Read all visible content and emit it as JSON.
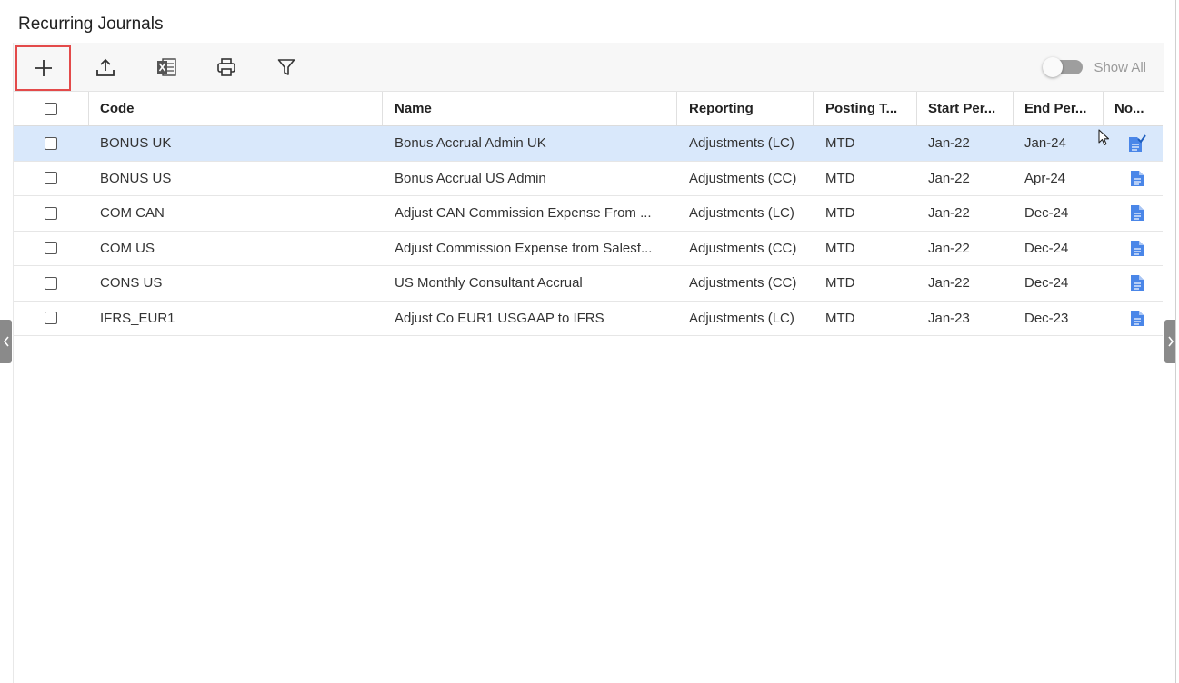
{
  "page": {
    "title": "Recurring Journals"
  },
  "toolbar": {
    "buttons": [
      {
        "name": "add-button",
        "icon": "plus-icon"
      },
      {
        "name": "upload-button",
        "icon": "upload-icon"
      },
      {
        "name": "excel-button",
        "icon": "excel-icon"
      },
      {
        "name": "print-button",
        "icon": "printer-icon"
      },
      {
        "name": "filter-button",
        "icon": "filter-icon"
      }
    ],
    "show_all": {
      "label": "Show All",
      "on": false
    }
  },
  "grid": {
    "columns": [
      "Code",
      "Name",
      "Reporting",
      "Posting T...",
      "Start Per...",
      "End Per...",
      "No..."
    ],
    "rows": [
      {
        "code": "BONUS UK",
        "name": "Bonus Accrual Admin UK",
        "reporting": "Adjustments (LC)",
        "posting": "MTD",
        "start": "Jan-22",
        "end": "Jan-24",
        "note_icon": "document-check-icon",
        "selected": true
      },
      {
        "code": "BONUS US",
        "name": "Bonus Accrual US Admin",
        "reporting": "Adjustments (CC)",
        "posting": "MTD",
        "start": "Jan-22",
        "end": "Apr-24",
        "note_icon": "document-icon",
        "selected": false
      },
      {
        "code": "COM CAN",
        "name": "Adjust CAN Commission Expense From ...",
        "reporting": "Adjustments (LC)",
        "posting": "MTD",
        "start": "Jan-22",
        "end": "Dec-24",
        "note_icon": "document-icon",
        "selected": false
      },
      {
        "code": "COM US",
        "name": "Adjust Commission Expense from Salesf...",
        "reporting": "Adjustments (CC)",
        "posting": "MTD",
        "start": "Jan-22",
        "end": "Dec-24",
        "note_icon": "document-icon",
        "selected": false
      },
      {
        "code": "CONS US",
        "name": "US Monthly Consultant Accrual",
        "reporting": "Adjustments (CC)",
        "posting": "MTD",
        "start": "Jan-22",
        "end": "Dec-24",
        "note_icon": "document-icon",
        "selected": false
      },
      {
        "code": "IFRS_EUR1",
        "name": "Adjust Co EUR1 USGAAP to IFRS",
        "reporting": "Adjustments (LC)",
        "posting": "MTD",
        "start": "Jan-23",
        "end": "Dec-23",
        "note_icon": "document-icon",
        "selected": false
      }
    ]
  },
  "colors": {
    "selected_row": "#d9e8fb",
    "highlight_border": "#e34a4a",
    "doc_icon": "#4a86e8",
    "check_mark": "#1f5fbf"
  }
}
